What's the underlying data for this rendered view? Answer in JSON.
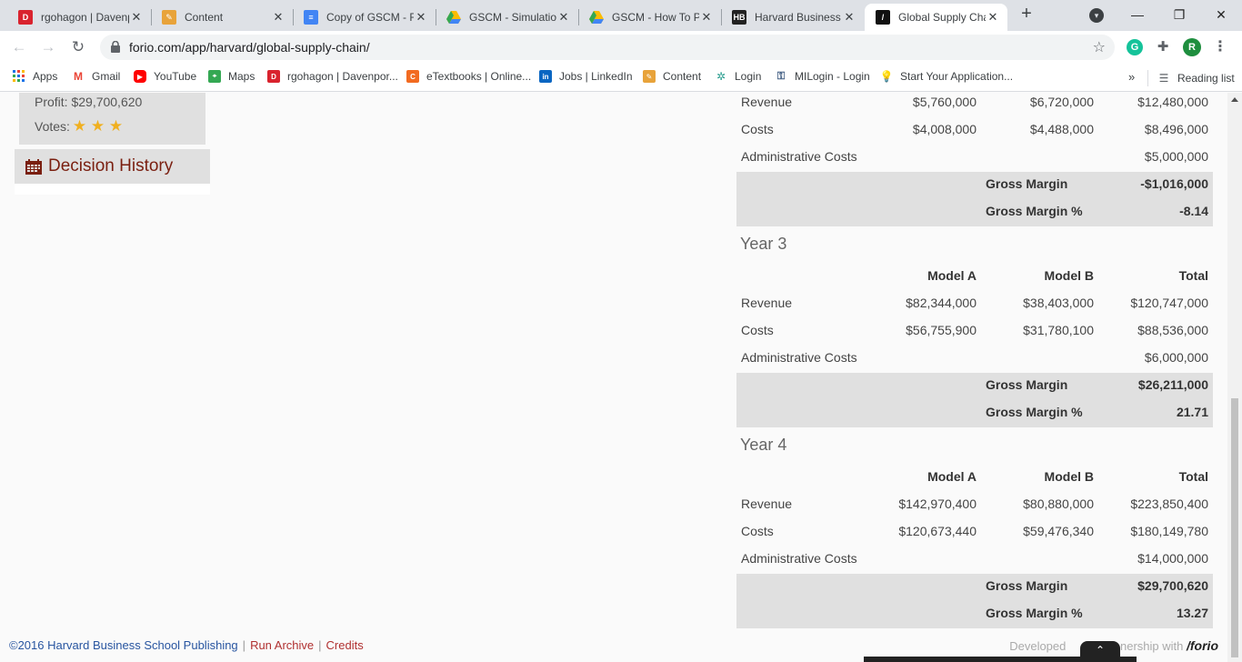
{
  "browser": {
    "tabs": [
      {
        "title": "rgohagon | Davenp",
        "favicon": "davenport-icon",
        "color": "#d9232e",
        "active": false
      },
      {
        "title": "Content",
        "favicon": "pencil-icon",
        "color": "#e8a33a",
        "active": false
      },
      {
        "title": "Copy of GSCM - Re",
        "favicon": "docs-icon",
        "color": "#4285f4",
        "active": false
      },
      {
        "title": "GSCM - Simulation",
        "favicon": "drive-icon",
        "color": "#34a853",
        "active": false
      },
      {
        "title": "GSCM - How To Pla",
        "favicon": "drive-icon",
        "color": "#34a853",
        "active": false
      },
      {
        "title": "Harvard Business P",
        "favicon": "hbp-icon",
        "color": "#222222",
        "active": false
      },
      {
        "title": "Global Supply Chai",
        "favicon": "forio-icon",
        "color": "#111111",
        "active": true
      }
    ],
    "url": "forio.com/app/harvard/global-supply-chain/",
    "profile_initial": "R",
    "bookmarks": [
      {
        "label": "Apps",
        "icon": "apps-grid-icon"
      },
      {
        "label": "Gmail",
        "icon": "gmail-icon"
      },
      {
        "label": "YouTube",
        "icon": "youtube-icon"
      },
      {
        "label": "Maps",
        "icon": "maps-icon"
      },
      {
        "label": "rgohagon | Davenpor...",
        "icon": "davenport-icon"
      },
      {
        "label": "eTextbooks | Online...",
        "icon": "etextbooks-icon"
      },
      {
        "label": "Jobs | LinkedIn",
        "icon": "linkedin-icon"
      },
      {
        "label": "Content",
        "icon": "pencil-icon"
      },
      {
        "label": "Login",
        "icon": "login-icon"
      },
      {
        "label": "MILogin - Login",
        "icon": "key-icon"
      },
      {
        "label": "Start Your Application...",
        "icon": "bulb-icon"
      }
    ],
    "reading_list": "Reading list",
    "more_bookmarks": "»"
  },
  "sidebar": {
    "profit": "Profit: $29,700,620",
    "votes_label": "Votes:",
    "stars": "★ ★ ★",
    "decision_history": "Decision History"
  },
  "financials": {
    "partial_year": {
      "rows": [
        {
          "label": "Revenue",
          "a": "$5,760,000",
          "b": "$6,720,000",
          "total": "$12,480,000"
        },
        {
          "label": "Costs",
          "a": "$4,008,000",
          "b": "$4,488,000",
          "total": "$8,496,000"
        },
        {
          "label": "Administrative Costs",
          "a": "",
          "b": "",
          "total": "$5,000,000"
        }
      ],
      "gross_margin_label": "Gross Margin",
      "gross_margin": "-$1,016,000",
      "gross_margin_pct_label": "Gross Margin %",
      "gross_margin_pct": "-8.14"
    },
    "year3": {
      "title": "Year 3",
      "headers": {
        "a": "Model A",
        "b": "Model B",
        "total": "Total"
      },
      "rows": [
        {
          "label": "Revenue",
          "a": "$82,344,000",
          "b": "$38,403,000",
          "total": "$120,747,000"
        },
        {
          "label": "Costs",
          "a": "$56,755,900",
          "b": "$31,780,100",
          "total": "$88,536,000"
        },
        {
          "label": "Administrative Costs",
          "a": "",
          "b": "",
          "total": "$6,000,000"
        }
      ],
      "gross_margin_label": "Gross Margin",
      "gross_margin": "$26,211,000",
      "gross_margin_pct_label": "Gross Margin %",
      "gross_margin_pct": "21.71"
    },
    "year4": {
      "title": "Year 4",
      "headers": {
        "a": "Model A",
        "b": "Model B",
        "total": "Total"
      },
      "rows": [
        {
          "label": "Revenue",
          "a": "$142,970,400",
          "b": "$80,880,000",
          "total": "$223,850,400"
        },
        {
          "label": "Costs",
          "a": "$120,673,440",
          "b": "$59,476,340",
          "total": "$180,149,780"
        },
        {
          "label": "Administrative Costs",
          "a": "",
          "b": "",
          "total": "$14,000,000"
        }
      ],
      "gross_margin_label": "Gross Margin",
      "gross_margin": "$29,700,620",
      "gross_margin_pct_label": "Gross Margin %",
      "gross_margin_pct": "13.27"
    }
  },
  "footer": {
    "copyright": "©2016 Harvard Business School Publishing",
    "run_archive": "Run Archive",
    "credits": "Credits",
    "separator": "|",
    "developed": "Developed",
    "partnership": "nership with",
    "forio_logo": "/forio"
  }
}
